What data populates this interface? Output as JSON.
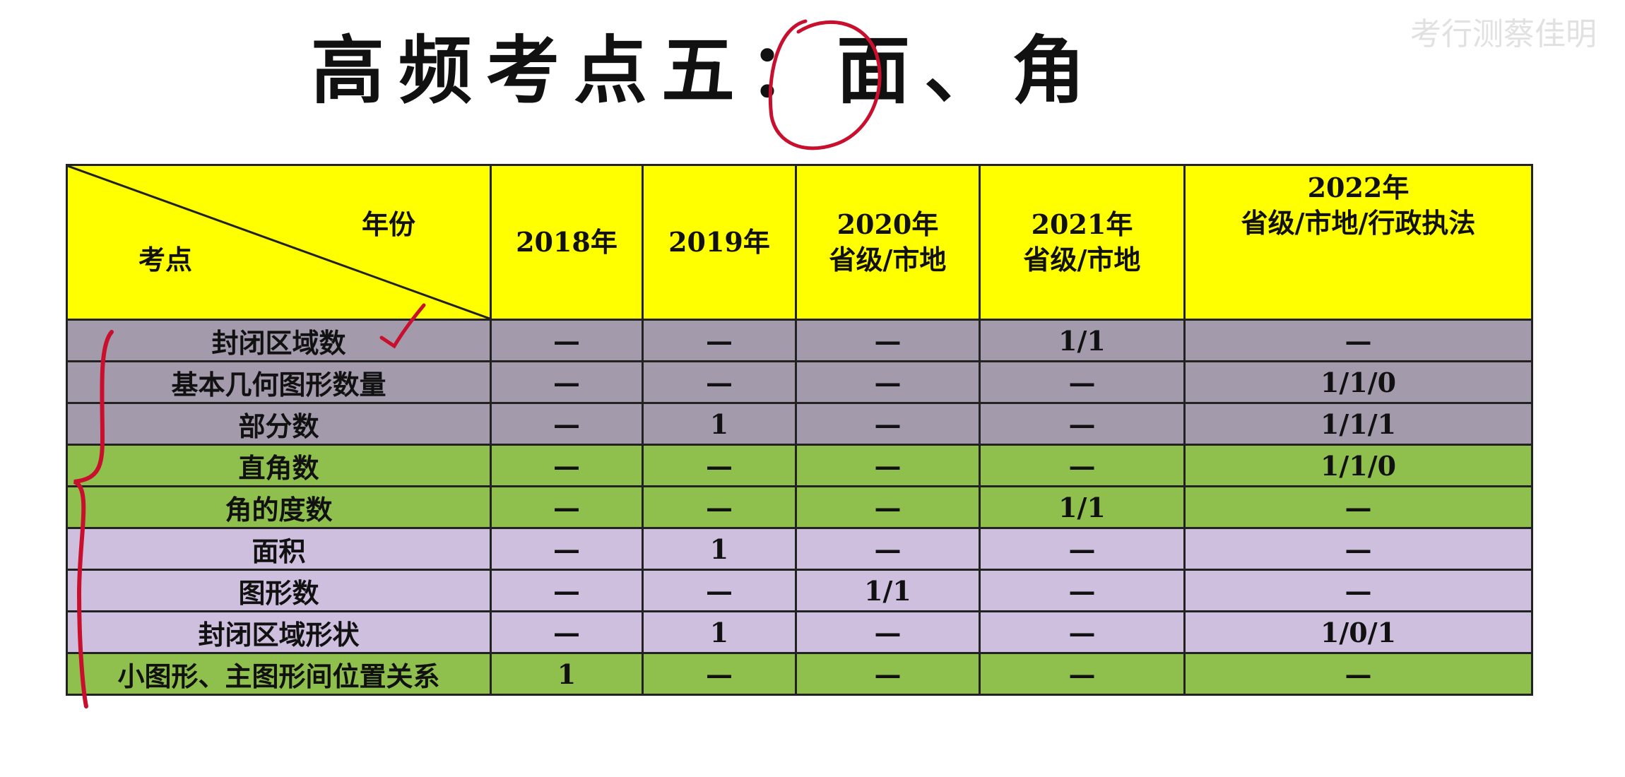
{
  "title": "高频考点五：面、角",
  "watermark": "考行测蔡佳明",
  "table": {
    "corner": {
      "year_label": "年份",
      "topic_label": "考点"
    },
    "columns": [
      {
        "line1": "2018年",
        "line2": ""
      },
      {
        "line1": "2019年",
        "line2": ""
      },
      {
        "line1": "2020年",
        "line2": "省级/市地"
      },
      {
        "line1": "2021年",
        "line2": "省级/市地"
      },
      {
        "line1": "2022年",
        "line2": "省级/市地/行政执法"
      }
    ],
    "rows": [
      {
        "topic": "封闭区域数",
        "cells": [
          "—",
          "—",
          "—",
          "1/1",
          "—"
        ]
      },
      {
        "topic": "基本几何图形数量",
        "cells": [
          "—",
          "—",
          "—",
          "—",
          "1/1/0"
        ]
      },
      {
        "topic": "部分数",
        "cells": [
          "—",
          "1",
          "—",
          "—",
          "1/1/1"
        ]
      },
      {
        "topic": "直角数",
        "cells": [
          "—",
          "—",
          "—",
          "—",
          "1/1/0"
        ]
      },
      {
        "topic": "角的度数",
        "cells": [
          "—",
          "—",
          "—",
          "1/1",
          "—"
        ]
      },
      {
        "topic": "面积",
        "cells": [
          "—",
          "1",
          "—",
          "—",
          "—"
        ]
      },
      {
        "topic": "图形数",
        "cells": [
          "—",
          "—",
          "1/1",
          "—",
          "—"
        ]
      },
      {
        "topic": "封闭区域形状",
        "cells": [
          "—",
          "1",
          "—",
          "—",
          "1/0/1"
        ]
      },
      {
        "topic": "小图形、主图形间位置关系",
        "cells": [
          "1",
          "—",
          "—",
          "—",
          "—"
        ]
      }
    ]
  },
  "colors": {
    "header": "#ffff00",
    "purple_rows": "#a39aab",
    "green_rows": "#8fc04e",
    "lavender_rows": "#cdbfdd",
    "annotation_ink": "#c8102e"
  }
}
